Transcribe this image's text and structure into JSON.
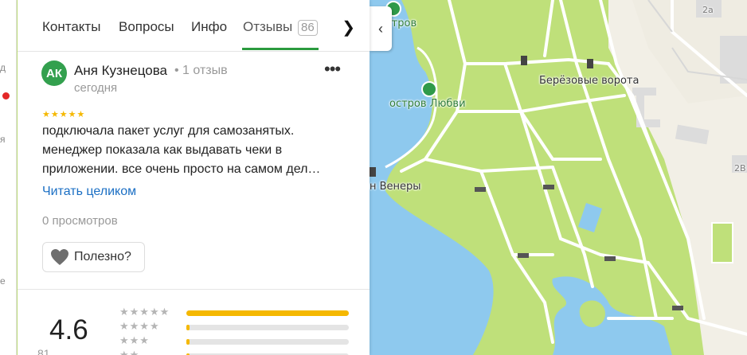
{
  "tabs": [
    {
      "label": "Контакты"
    },
    {
      "label": "Вопросы"
    },
    {
      "label": "Инфо"
    },
    {
      "label": "Отзывы",
      "badge": "86",
      "active": true
    }
  ],
  "left_strip": {
    "fragments": [
      "д",
      "я",
      "е"
    ]
  },
  "review": {
    "avatar_initials": "АК",
    "avatar_color": "#33a04e",
    "author": "Аня Кузнецова",
    "author_reviews": "1 отзыв",
    "date": "сегодня",
    "stars": 5,
    "stars_text": "★★★★★",
    "text_lines": [
      "подключала пакет услуг для самозанятых.",
      "менеджер показала как выдавать чеки в",
      "приложении. все очень просто на самом дел…"
    ],
    "read_more": "Читать целиком",
    "views": "0 просмотров",
    "useful_label": "Полезно?"
  },
  "summary": {
    "rating": "4.6",
    "count_fragment": "81",
    "distribution": [
      {
        "stars": 5,
        "stars_text": "★★★★★",
        "fraction": 1.0
      },
      {
        "stars": 4,
        "stars_text": "★★★★",
        "fraction": 0.02
      },
      {
        "stars": 3,
        "stars_text": "★★★",
        "fraction": 0.02
      },
      {
        "stars": 2,
        "stars_text": "★★",
        "fraction": 0.02
      }
    ]
  },
  "map": {
    "labels": {
      "island_top": "й остров",
      "island_love": "остров Любви",
      "birch_gate": "Берёзовые ворота",
      "venus": "н Венеры",
      "house_2a": "2а",
      "house_2b": "2В"
    },
    "colors": {
      "park": "#bfe07a",
      "water": "#8ec9ee",
      "path": "#ffffff",
      "built": "#f2efe6",
      "building": "#dcdcdc"
    }
  },
  "accent_color": "#2b9a3e",
  "link_color": "#1b6fc4",
  "star_color": "#f5b800"
}
